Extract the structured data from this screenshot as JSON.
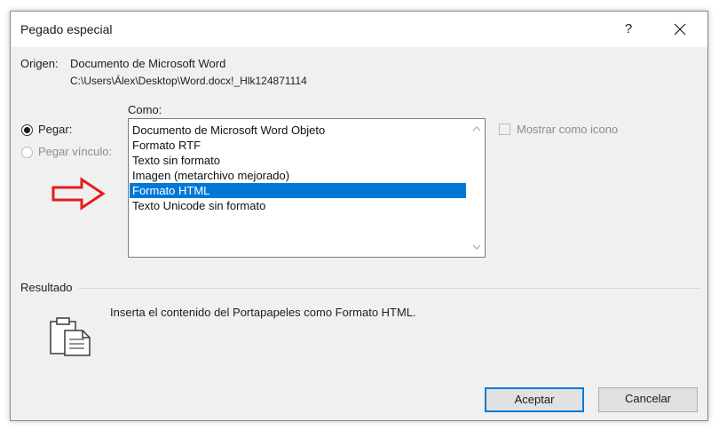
{
  "dialog": {
    "title": "Pegado especial",
    "help_label": "?",
    "close_icon": "close-icon"
  },
  "source": {
    "label": "Origen:",
    "document": "Documento de Microsoft Word",
    "path": "C:\\Users\\Álex\\Desktop\\Word.docx!_Hlk124871114"
  },
  "options": {
    "paste_label": "Pegar:",
    "paste_link_label": "Pegar vínculo:",
    "paste_selected": true
  },
  "as_list": {
    "label": "Como:",
    "items": [
      "Documento de Microsoft Word Objeto",
      "Formato RTF",
      "Texto sin formato",
      "Imagen (metarchivo mejorado)",
      "Formato HTML",
      "Texto Unicode sin formato"
    ],
    "selected_index": 4
  },
  "display_as_icon": {
    "label": "Mostrar como icono",
    "checked": false
  },
  "result": {
    "label": "Resultado",
    "text": "Inserta el contenido del Portapapeles como Formato HTML."
  },
  "buttons": {
    "accept": "Aceptar",
    "cancel": "Cancelar"
  },
  "colors": {
    "selection": "#0078d7",
    "annotation_arrow": "#e01e1e"
  }
}
